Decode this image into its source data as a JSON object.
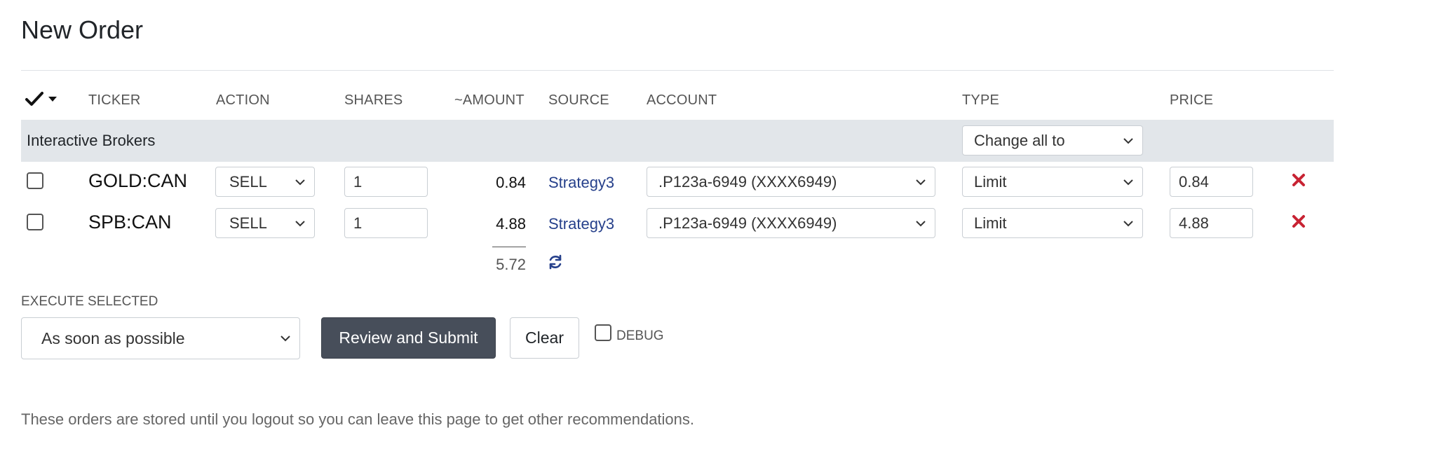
{
  "page": {
    "title": "New Order"
  },
  "table": {
    "columns": {
      "ticker": "TICKER",
      "action": "ACTION",
      "shares": "SHARES",
      "amount": "~AMOUNT",
      "source": "SOURCE",
      "account": "ACCOUNT",
      "type": "TYPE",
      "price": "PRICE"
    },
    "group": {
      "broker": "Interactive Brokers",
      "change_all_label": "Change all to"
    },
    "rows": [
      {
        "ticker": "GOLD:CAN",
        "action": "SELL",
        "shares": "1",
        "amount": "0.84",
        "source": "Strategy3",
        "account": ".P123a-6949 (XXXX6949)",
        "type": "Limit",
        "price": "0.84"
      },
      {
        "ticker": "SPB:CAN",
        "action": "SELL",
        "shares": "1",
        "amount": "4.88",
        "source": "Strategy3",
        "account": ".P123a-6949 (XXXX6949)",
        "type": "Limit",
        "price": "4.88"
      }
    ],
    "total_amount": "5.72"
  },
  "execute": {
    "label": "EXECUTE SELECTED",
    "timing": "As soon as possible",
    "submit_label": "Review and Submit",
    "clear_label": "Clear",
    "debug_label": "DEBUG"
  },
  "footer": {
    "note": "These orders are stored until you logout so you can leave this page to get other recommendations."
  },
  "colors": {
    "group_bg": "#e2e6ea",
    "primary_btn": "#474e5a",
    "link": "#26408b",
    "remove": "#c82333"
  },
  "icons": {
    "select_all": "checkmark-icon",
    "select_all_menu": "caret-down-icon",
    "dropdown": "chevron-down-icon",
    "remove": "close-x-icon",
    "refresh": "refresh-icon"
  }
}
